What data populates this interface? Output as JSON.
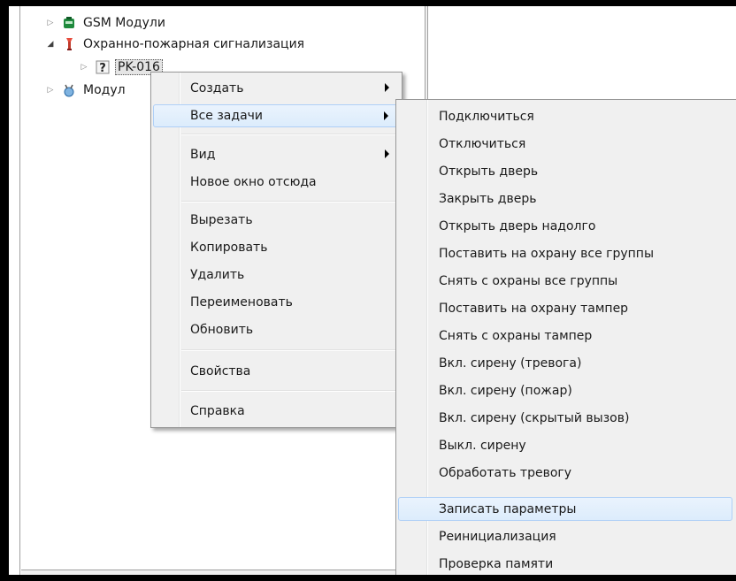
{
  "tree": {
    "items": [
      {
        "label": "GSM Модули",
        "icon": "gsm-module-icon",
        "expander": "collapsed"
      },
      {
        "label": "Охранно-пожарная сигнализация",
        "icon": "fire-alarm-icon",
        "expander": "expanded"
      },
      {
        "label": "PK-016",
        "icon": "unknown-device-icon",
        "expander": "collapsed",
        "selected": true
      },
      {
        "label": "Модул",
        "icon": "module-icon",
        "expander": "collapsed"
      }
    ]
  },
  "context_menu": {
    "items": [
      {
        "label": "Создать",
        "submenu": true
      },
      {
        "label": "Все задачи",
        "submenu": true,
        "highlighted": true
      },
      {
        "label": "Вид",
        "submenu": true
      },
      {
        "label": "Новое окно отсюда"
      },
      {
        "label": "Вырезать"
      },
      {
        "label": "Копировать"
      },
      {
        "label": "Удалить"
      },
      {
        "label": "Переименовать"
      },
      {
        "label": "Обновить"
      },
      {
        "label": "Свойства"
      },
      {
        "label": "Справка"
      }
    ]
  },
  "submenu": {
    "items": [
      "Подключиться",
      "Отключиться",
      "Открыть дверь",
      "Закрыть дверь",
      "Открыть дверь надолго",
      "Поставить на охрану все группы",
      "Снять с охраны все группы",
      "Поставить на охрану тампер",
      "Снять с охраны тампер",
      "Вкл. сирену (тревога)",
      "Вкл. сирену (пожар)",
      "Вкл. сирену (скрытый вызов)",
      "Выкл. сирену",
      "Обработать тревогу",
      "Записать параметры",
      "Реинициализация",
      "Проверка памяти"
    ],
    "highlighted_index": 14
  },
  "colors": {
    "menu_bg": "#f0f0f0",
    "highlight_border": "#aecff7",
    "highlight_fill": "#dcecfc"
  }
}
